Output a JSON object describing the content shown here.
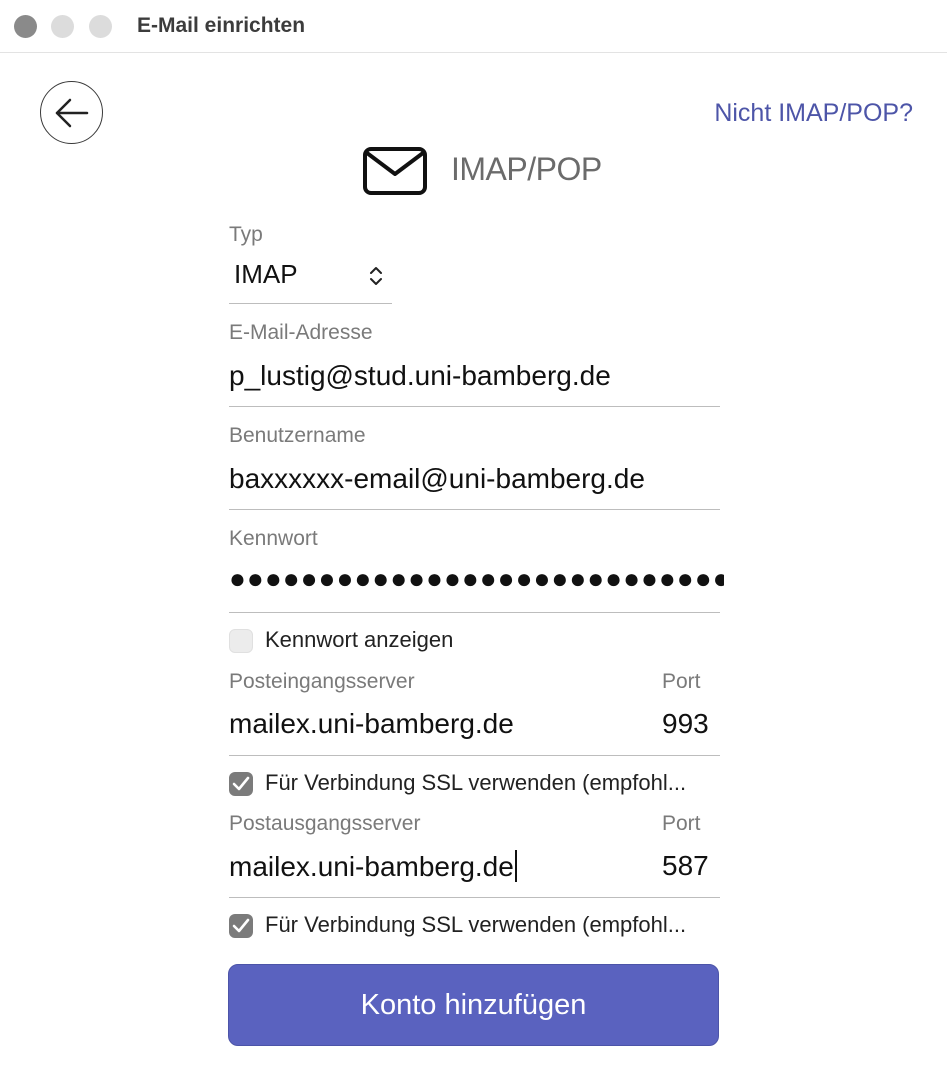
{
  "window": {
    "title": "E-Mail einrichten"
  },
  "header": {
    "not_imap_link": "Nicht IMAP/POP?",
    "heading": "IMAP/POP",
    "heading_icon": "envelope-icon",
    "back_icon": "arrow-left-icon"
  },
  "form": {
    "type_label": "Typ",
    "type_value": "IMAP",
    "email_label": "E-Mail-Adresse",
    "email_value": "p_lustig@stud.uni-bamberg.de",
    "username_label": "Benutzername",
    "username_value": "baxxxxxx-email@uni-bamberg.de",
    "password_label": "Kennwort",
    "password_masked": "●●●●●●●●●●●●●●●●●●●●●●●●●●●●●●●●●●●●",
    "show_password_label": "Kennwort anzeigen",
    "show_password_checked": false,
    "incoming_label": "Posteingangsserver",
    "incoming_value": "mailex.uni-bamberg.de",
    "incoming_port_label": "Port",
    "incoming_port_value": "993",
    "incoming_ssl_label": "Für Verbindung SSL verwenden (empfohl...",
    "incoming_ssl_checked": true,
    "outgoing_label": "Postausgangsserver",
    "outgoing_value": "mailex.uni-bamberg.de",
    "outgoing_port_label": "Port",
    "outgoing_port_value": "587",
    "outgoing_ssl_label": "Für Verbindung SSL verwenden (empfohl...",
    "outgoing_ssl_checked": true
  },
  "actions": {
    "submit_label": "Konto hinzufügen"
  },
  "colors": {
    "accent": "#5a62bf",
    "link": "#4d55a8"
  }
}
